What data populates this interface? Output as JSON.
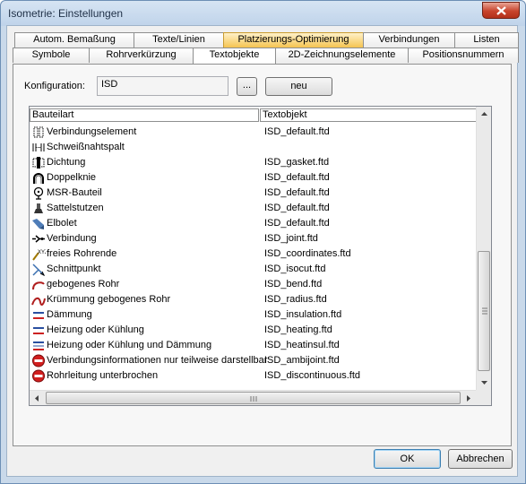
{
  "window": {
    "title": "Isometrie: Einstellungen"
  },
  "tabs_row1": [
    {
      "label": "Autom. Bemaßung"
    },
    {
      "label": "Texte/Linien"
    },
    {
      "label": "Platzierungs-Optimierung"
    },
    {
      "label": "Verbindungen"
    },
    {
      "label": "Listen"
    }
  ],
  "tabs_row2": [
    {
      "label": "Symbole"
    },
    {
      "label": "Rohrverkürzung"
    },
    {
      "label": "Textobjekte"
    },
    {
      "label": "2D-Zeichnungselemente"
    },
    {
      "label": "Positionsnummern"
    }
  ],
  "config": {
    "label": "Konfiguration:",
    "value": "ISD",
    "browse_label": "...",
    "new_label": "neu"
  },
  "table": {
    "col1": "Bauteilart",
    "col2": "Textobjekt",
    "rows": [
      {
        "icon": "connection-element-icon",
        "name": "Verbindungselement",
        "value": "ISD_default.ftd"
      },
      {
        "icon": "weld-gap-icon",
        "name": "Schweißnahtspalt",
        "value": ""
      },
      {
        "icon": "gasket-icon",
        "name": "Dichtung",
        "value": "ISD_gasket.ftd"
      },
      {
        "icon": "double-bend-icon",
        "name": "Doppelknie",
        "value": "ISD_default.ftd"
      },
      {
        "icon": "msr-component-icon",
        "name": "MSR-Bauteil",
        "value": "ISD_default.ftd"
      },
      {
        "icon": "saddle-nozzle-icon",
        "name": "Sattelstutzen",
        "value": "ISD_default.ftd"
      },
      {
        "icon": "elbolet-icon",
        "name": "Elbolet",
        "value": "ISD_default.ftd"
      },
      {
        "icon": "connection-icon",
        "name": "Verbindung",
        "value": "ISD_joint.ftd"
      },
      {
        "icon": "coordinates-icon",
        "name": "freies Rohrende",
        "value": "ISD_coordinates.ftd"
      },
      {
        "icon": "intersection-icon",
        "name": "Schnittpunkt",
        "value": "ISD_isocut.ftd"
      },
      {
        "icon": "bent-pipe-icon",
        "name": "gebogenes Rohr",
        "value": "ISD_bend.ftd"
      },
      {
        "icon": "curvature-icon",
        "name": "Krümmung gebogenes Rohr",
        "value": "ISD_radius.ftd"
      },
      {
        "icon": "insulation-icon",
        "name": "Dämmung",
        "value": "ISD_insulation.ftd"
      },
      {
        "icon": "heating-icon",
        "name": "Heizung oder Kühlung",
        "value": "ISD_heating.ftd"
      },
      {
        "icon": "heating-insulation-icon",
        "name": "Heizung oder Kühlung und Dämmung",
        "value": "ISD_heatinsul.ftd"
      },
      {
        "icon": "no-entry-icon",
        "name": "Verbindungsinformationen nur teilweise darstellbar",
        "value": "ISD_ambijoint.ftd"
      },
      {
        "icon": "no-entry-icon",
        "name": "Rohrleitung unterbrochen",
        "value": "ISD_discontinuous.ftd"
      }
    ]
  },
  "buttons": {
    "ok_label": "OK",
    "cancel_label": "Abbrechen"
  },
  "colors": {
    "active_tab_accent": "#f5c451",
    "window_frame": "#c9d9ea",
    "close_button": "#c8442d"
  }
}
